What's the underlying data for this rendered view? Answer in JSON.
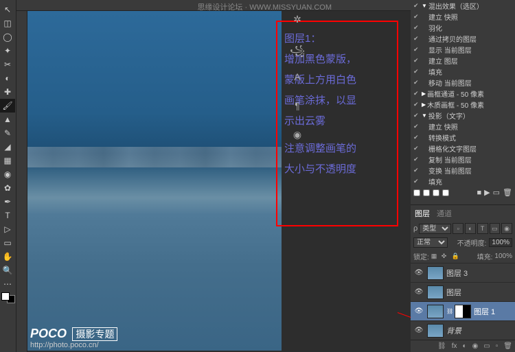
{
  "annotation": {
    "title": "图层1：",
    "line1": "增加黑色蒙版，",
    "line2": "蒙版上方用白色",
    "line3": "画笔涂抹，以显",
    "line4": "示出云雾",
    "line5": "注意调整画笔的",
    "line6": "大小与不透明度"
  },
  "top_watermark": "思缘设计论坛",
  "top_watermark_url": "WWW.MISSYUAN.COM",
  "watermark": {
    "logo": "POCO",
    "sub": "摄影专题",
    "url": "http://photo.poco.cn/"
  },
  "actions": {
    "group1": "混出效果（选区）",
    "items1": [
      "建立 快照",
      "羽化",
      "通过拷贝的图层",
      "显示 当前图层",
      "建立 图层",
      "填充",
      "移动 当前图层"
    ],
    "group2": "画框通道 - 50 像素",
    "group3": "木质画框 - 50 像素",
    "group4": "投影（文字）",
    "items4": [
      "建立 快照",
      "转换模式",
      "栅格化文字图层",
      "复制 当前图层",
      "变换 当前图层",
      "填充"
    ],
    "checkboxes": []
  },
  "layers_panel": {
    "tab1": "图层",
    "tab2": "通道",
    "filter_kind": "类型",
    "blend_mode": "正常",
    "opacity_label": "不透明度:",
    "opacity_value": "100%",
    "lock_label": "锁定:",
    "fill_label": "填充:",
    "fill_value": "100%",
    "layers": [
      {
        "name": "图层 3"
      },
      {
        "name": "图层"
      },
      {
        "name": "图层 1"
      },
      {
        "name": "背景"
      }
    ]
  },
  "tools": [
    "↖",
    "◫",
    "▭",
    "✦",
    "⬚",
    "◐",
    "✎",
    "⟋",
    "◉",
    "✐",
    "T",
    "▷",
    "✋",
    "🔍"
  ]
}
